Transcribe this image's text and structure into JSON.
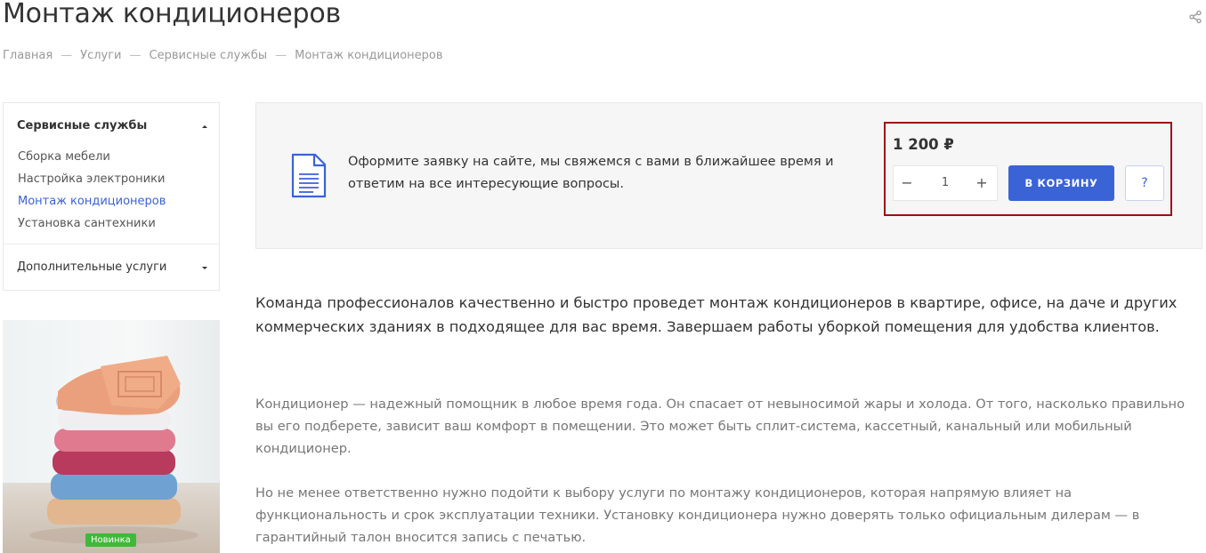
{
  "page": {
    "title": "Монтаж кондиционеров",
    "share_icon": "share-icon"
  },
  "breadcrumb": {
    "items": [
      "Главная",
      "Услуги",
      "Сервисные службы",
      "Монтаж кондиционеров"
    ],
    "separator": "—"
  },
  "sidebar": {
    "section_title": "Сервисные службы",
    "items": [
      {
        "label": "Сборка мебели",
        "active": false
      },
      {
        "label": "Настройка электроники",
        "active": false
      },
      {
        "label": "Монтаж кондиционеров",
        "active": true
      },
      {
        "label": "Установка сантехники",
        "active": false
      }
    ],
    "section2_title": "Дополнительные услуги"
  },
  "promo": {
    "badge": "Новинка",
    "badge_color": "#3fb93a"
  },
  "order": {
    "text": "Оформите заявку на сайте, мы свяжемся с вами в ближайшее время и ответим на все интересующие вопросы.",
    "price": "1 200 ₽",
    "quantity": "1",
    "minus_symbol": "−",
    "plus_symbol": "+",
    "cart_button": "В КОРЗИНУ",
    "help_button": "?",
    "accent_color": "#3a63d6",
    "highlight_color": "#a10d12"
  },
  "description": {
    "lead": "Команда профессионалов качественно и быстро проведет монтаж кондиционеров в квартире, офисе, на даче и других коммерческих зданиях в подходящее для вас время. Завершаем работы уборкой помещения для удобства клиентов.",
    "para1": "Кондиционер — надежный помощник в любое время года. Он спасает от невыносимой жары и холода. От того, насколько правильно вы его подберете, зависит ваш комфорт в помещении. Это может быть сплит-система, кассетный, канальный или мобильный кондиционер.",
    "para2": "Но не менее ответственно нужно подойти к выбору услуги по монтажу кондиционеров, которая напрямую влияет на функциональность и срок эксплуатации техники. Установку кондиционера нужно доверять только официальным дилерам — в гарантийный талон вносится запись с печатью."
  }
}
